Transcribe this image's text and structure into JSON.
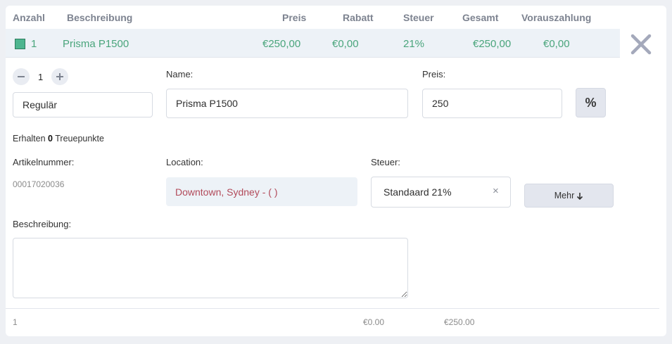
{
  "table_header": {
    "qty": "Anzahl",
    "description": "Beschreibung",
    "price": "Preis",
    "discount": "Rabatt",
    "tax": "Steuer",
    "total": "Gesamt",
    "prepayment": "Vorauszahlung"
  },
  "line_item": {
    "qty": "1",
    "name": "Prisma P1500",
    "price": "€250,00",
    "discount": "€0,00",
    "tax": "21%",
    "total": "€250,00",
    "prepayment": "€0,00"
  },
  "editor": {
    "quantity": "1",
    "price_type": "Regulär",
    "name_label": "Name:",
    "name_value": "Prisma P1500",
    "price_label": "Preis:",
    "price_value": "250",
    "percent_button": "%",
    "loyalty_prefix": "Erhalten",
    "loyalty_points": "0",
    "loyalty_suffix": "Treuepunkte",
    "article_label": "Artikelnummer:",
    "article_value": "00017020036",
    "location_label": "Location:",
    "location_value": "Downtown, Sydney - ( )",
    "tax_label": "Steuer:",
    "tax_value": "Standaard 21%",
    "tax_clear": "×",
    "more_button": "Mehr",
    "description_label": "Beschreibung:",
    "description_value": ""
  },
  "footer": {
    "qty": "1",
    "discount": "€0.00",
    "total": "€250.00"
  },
  "colors": {
    "accent_green": "#4aa57c",
    "location_red": "#b24a5a",
    "row_highlight": "#edf2f7"
  },
  "icons": {
    "color_chip": "green-square-icon",
    "close": "close-icon",
    "minus": "minus-icon",
    "plus": "plus-icon",
    "arrow": "arrow-down-icon"
  }
}
